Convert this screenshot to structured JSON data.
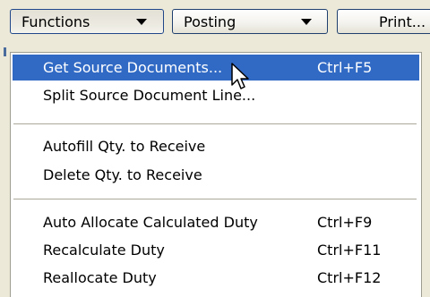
{
  "toolbar": {
    "functions_label": "Functions",
    "posting_label": "Posting",
    "print_label": "Print..."
  },
  "menu": {
    "items": [
      {
        "label": "Get Source Documents...",
        "shortcut": "Ctrl+F5"
      },
      {
        "label": "Split Source Document Line...",
        "shortcut": ""
      },
      {
        "label": "Autofill Qty. to Receive",
        "shortcut": ""
      },
      {
        "label": "Delete Qty. to Receive",
        "shortcut": ""
      },
      {
        "label": "Auto Allocate Calculated Duty",
        "shortcut": "Ctrl+F9"
      },
      {
        "label": "Recalculate Duty",
        "shortcut": "Ctrl+F11"
      },
      {
        "label": "Reallocate Duty",
        "shortcut": "Ctrl+F12"
      }
    ],
    "selected_index": 0
  },
  "colors": {
    "highlight": "#316ac5",
    "menu_background": "#ffffff",
    "window_background": "#ece9d8"
  },
  "icons": {
    "cursor": "mouse-pointer-icon",
    "dropdown": "dropdown-arrow-icon"
  }
}
